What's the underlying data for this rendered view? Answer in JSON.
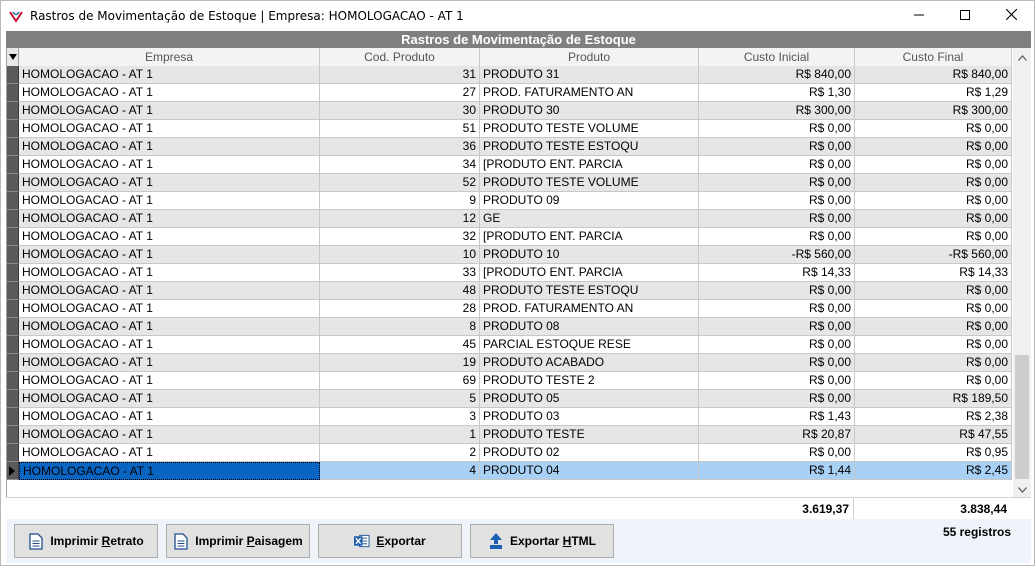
{
  "window": {
    "title": "Rastros de Movimentação de Estoque | Empresa: HOMOLOGACAO - AT 1",
    "banner": "Rastros de Movimentação de Estoque"
  },
  "columns": [
    "Empresa",
    "Cod. Produto",
    "Produto",
    "Custo Inicial",
    "Custo Final"
  ],
  "rows": [
    [
      "HOMOLOGACAO - AT 1",
      "31",
      "PRODUTO 31",
      "R$ 840,00",
      "R$ 840,00"
    ],
    [
      "HOMOLOGACAO - AT 1",
      "27",
      "PROD. FATURAMENTO AN",
      "R$ 1,30",
      "R$ 1,29"
    ],
    [
      "HOMOLOGACAO - AT 1",
      "30",
      "PRODUTO 30",
      "R$ 300,00",
      "R$ 300,00"
    ],
    [
      "HOMOLOGACAO - AT 1",
      "51",
      "PRODUTO TESTE VOLUME",
      "R$ 0,00",
      "R$ 0,00"
    ],
    [
      "HOMOLOGACAO - AT 1",
      "36",
      "PRODUTO TESTE ESTOQU",
      "R$ 0,00",
      "R$ 0,00"
    ],
    [
      "HOMOLOGACAO - AT 1",
      "34",
      "[PRODUTO ENT. PARCIA",
      "R$ 0,00",
      "R$ 0,00"
    ],
    [
      "HOMOLOGACAO - AT 1",
      "52",
      "PRODUTO TESTE VOLUME",
      "R$ 0,00",
      "R$ 0,00"
    ],
    [
      "HOMOLOGACAO - AT 1",
      "9",
      "PRODUTO 09",
      "R$ 0,00",
      "R$ 0,00"
    ],
    [
      "HOMOLOGACAO - AT 1",
      "12",
      "GE",
      "R$ 0,00",
      "R$ 0,00"
    ],
    [
      "HOMOLOGACAO - AT 1",
      "32",
      "[PRODUTO ENT. PARCIA",
      "R$ 0,00",
      "R$ 0,00"
    ],
    [
      "HOMOLOGACAO - AT 1",
      "10",
      "PRODUTO 10",
      "-R$ 560,00",
      "-R$ 560,00"
    ],
    [
      "HOMOLOGACAO - AT 1",
      "33",
      "[PRODUTO ENT. PARCIA",
      "R$ 14,33",
      "R$ 14,33"
    ],
    [
      "HOMOLOGACAO - AT 1",
      "48",
      "PRODUTO TESTE ESTOQU",
      "R$ 0,00",
      "R$ 0,00"
    ],
    [
      "HOMOLOGACAO - AT 1",
      "28",
      "PROD. FATURAMENTO AN",
      "R$ 0,00",
      "R$ 0,00"
    ],
    [
      "HOMOLOGACAO - AT 1",
      "8",
      "PRODUTO 08",
      "R$ 0,00",
      "R$ 0,00"
    ],
    [
      "HOMOLOGACAO - AT 1",
      "45",
      "PARCIAL ESTOQUE RESE",
      "R$ 0,00",
      "R$ 0,00"
    ],
    [
      "HOMOLOGACAO - AT 1",
      "19",
      "PRODUTO ACABADO",
      "R$ 0,00",
      "R$ 0,00"
    ],
    [
      "HOMOLOGACAO - AT 1",
      "69",
      "PRODUTO TESTE 2",
      "R$ 0,00",
      "R$ 0,00"
    ],
    [
      "HOMOLOGACAO - AT 1",
      "5",
      "PRODUTO 05",
      "R$ 0,00",
      "R$ 189,50"
    ],
    [
      "HOMOLOGACAO - AT 1",
      "3",
      "PRODUTO 03",
      "R$ 1,43",
      "R$ 2,38"
    ],
    [
      "HOMOLOGACAO - AT 1",
      "1",
      "PRODUTO TESTE",
      "R$ 20,87",
      "R$ 47,55"
    ],
    [
      "HOMOLOGACAO - AT 1",
      "2",
      "PRODUTO 02",
      "R$ 0,00",
      "R$ 0,95"
    ],
    [
      "HOMOLOGACAO - AT 1",
      "4",
      "PRODUTO 04",
      "R$ 1,44",
      "R$ 2,45"
    ]
  ],
  "selected_row": 22,
  "totals": {
    "custo_inicial": "3.619,37",
    "custo_final": "3.838,44"
  },
  "record_count": "55 registros",
  "buttons": {
    "imprimir_retrato": {
      "pre": "Imprimir ",
      "u": "R",
      "post": "etrato"
    },
    "imprimir_paisagem": {
      "pre": "Imprimir ",
      "u": "P",
      "post": "aisagem"
    },
    "exportar": {
      "pre": "",
      "u": "E",
      "post": "xportar"
    },
    "exportar_html": {
      "pre": "Exportar ",
      "u": "H",
      "post": "TML"
    }
  },
  "colors": {
    "banner": "#7f7f7f",
    "selection": "#a9d1f5",
    "selected_cell": "#0a64c2",
    "footer": "#eef4f9"
  },
  "icons": [
    "app-logo-icon",
    "minimize-icon",
    "maximize-icon",
    "close-icon",
    "document-icon",
    "excel-icon",
    "upload-icon",
    "scroll-up-icon",
    "scroll-down-icon"
  ]
}
